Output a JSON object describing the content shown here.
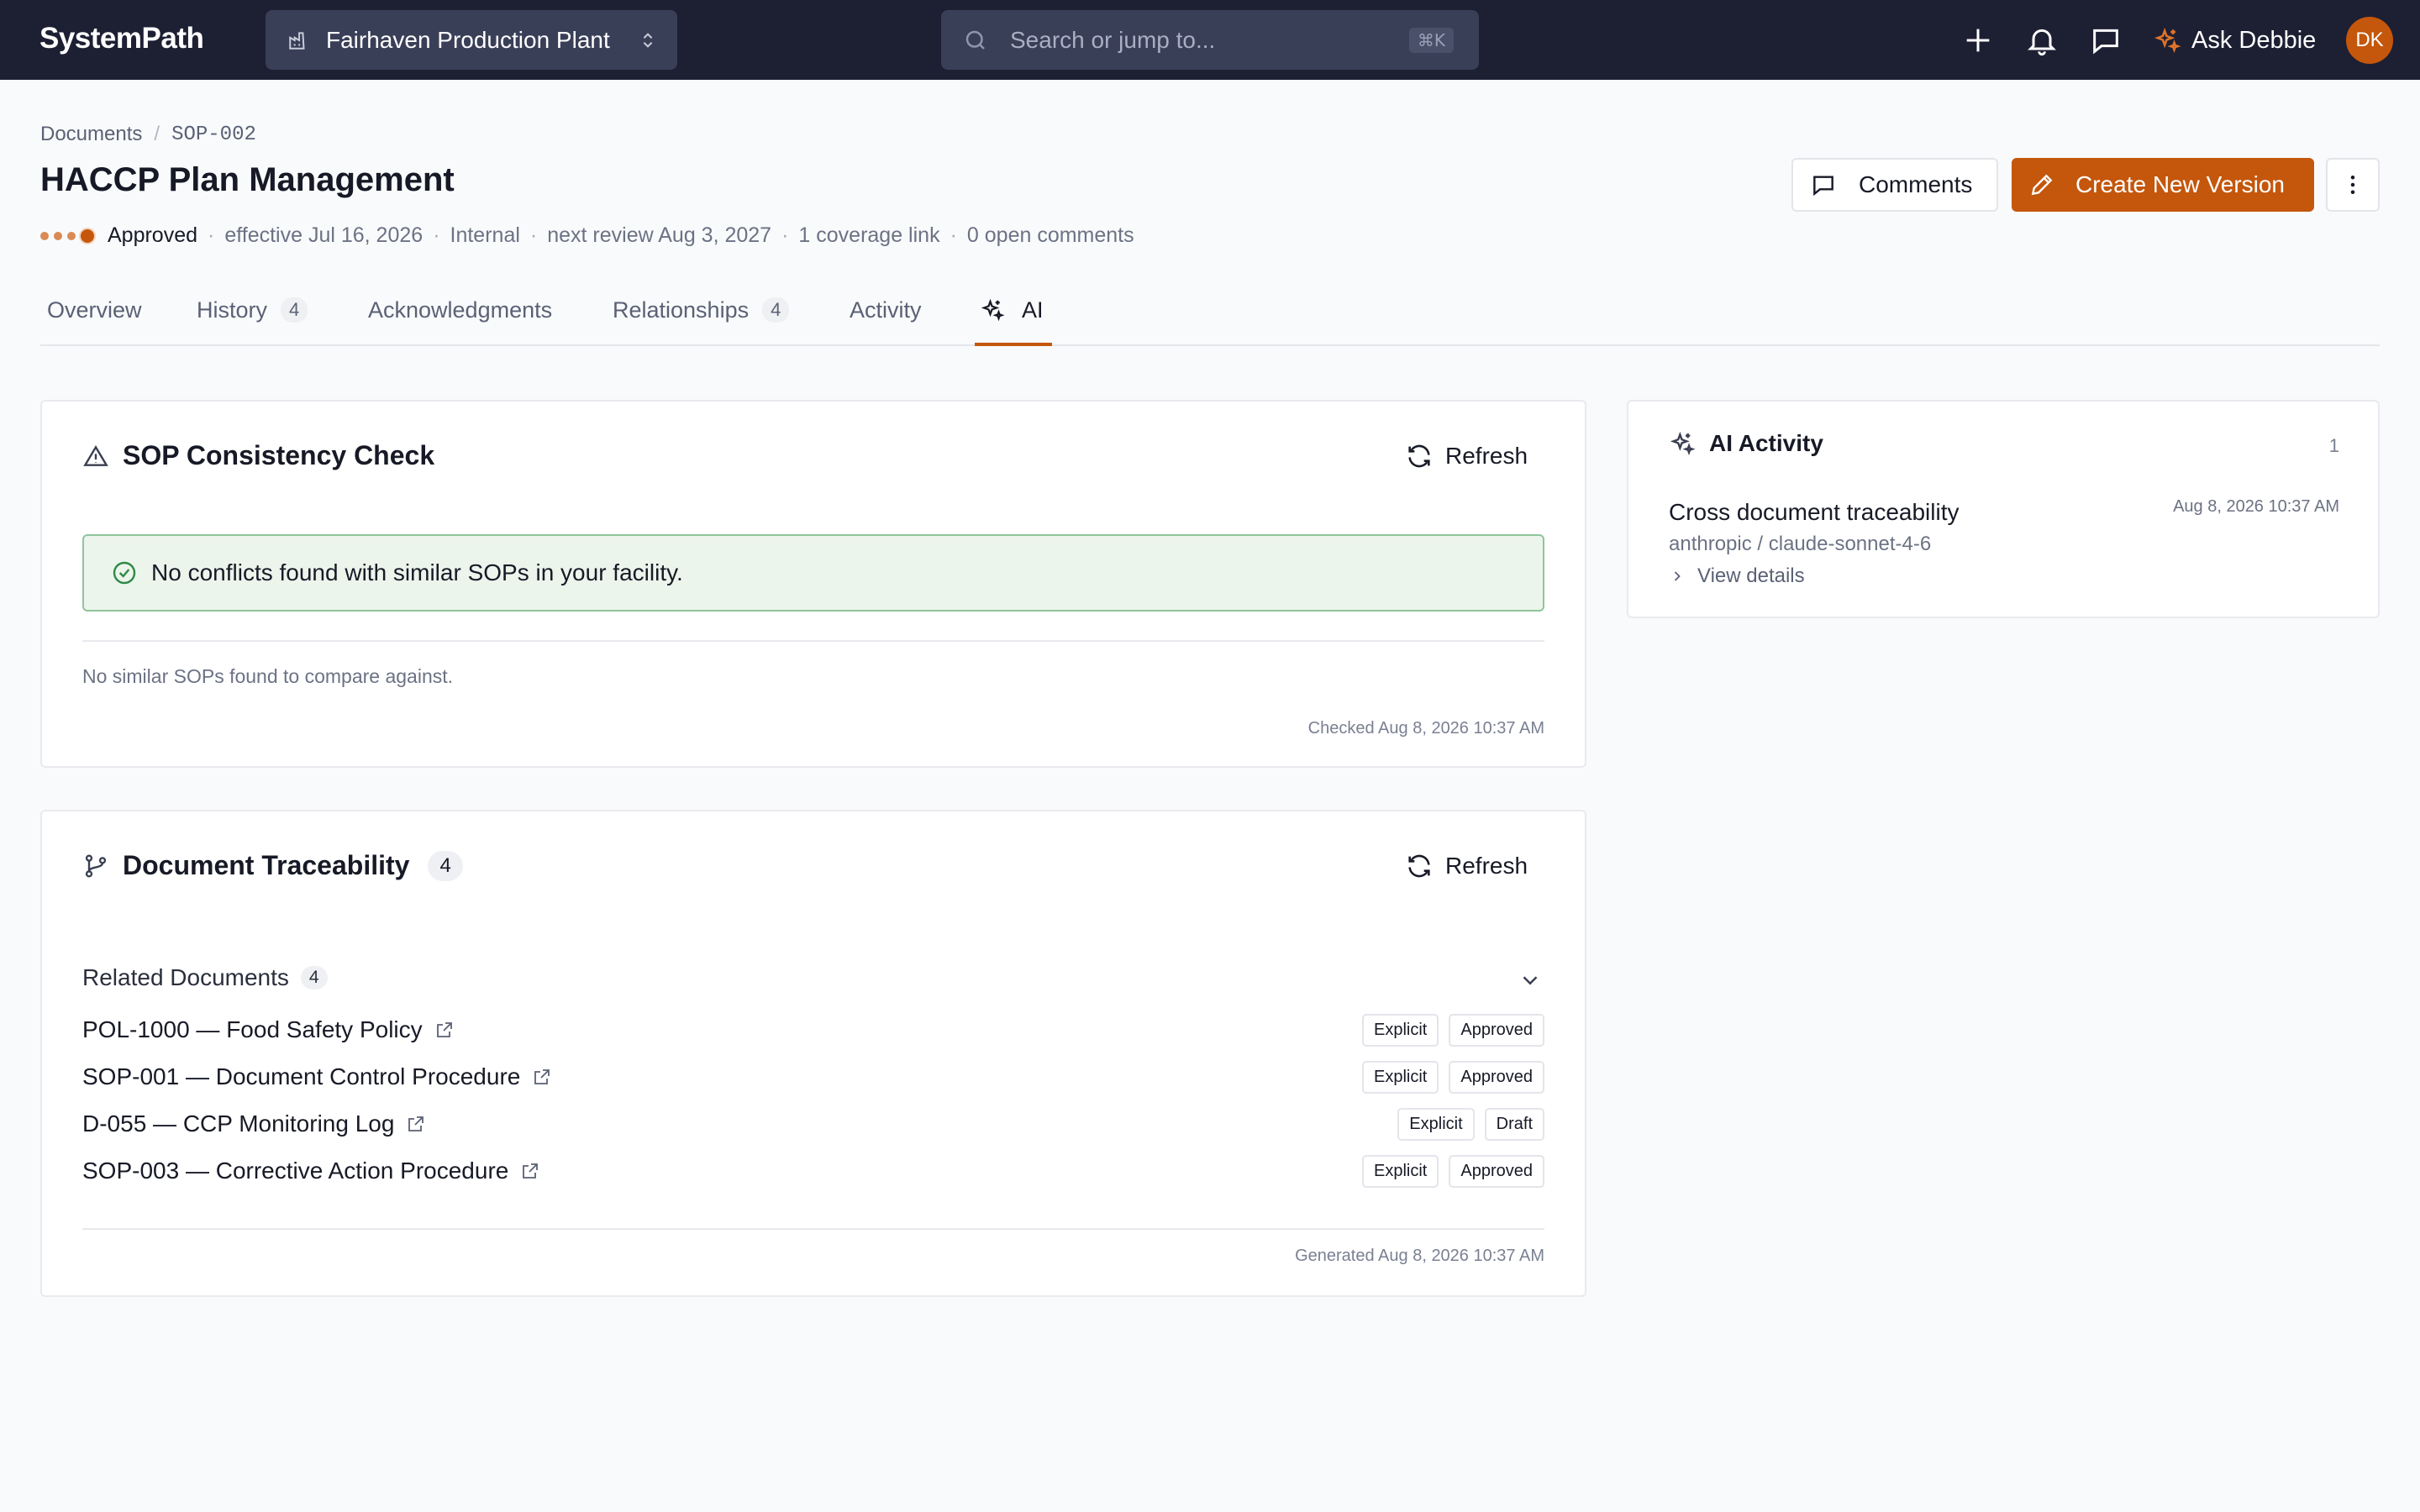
{
  "app": {
    "brand": "SystemPath"
  },
  "facility": {
    "name": "Fairhaven Production Plant"
  },
  "search": {
    "placeholder": "Search or jump to...",
    "shortcut": "⌘K"
  },
  "topbar": {
    "ask_label": "Ask Debbie",
    "avatar_initials": "DK"
  },
  "breadcrumb": {
    "root": "Documents",
    "current": "SOP-002"
  },
  "document": {
    "title": "HACCP Plan Management",
    "status": "Approved",
    "effective": "effective Jul 16, 2026",
    "visibility": "Internal",
    "next_review": "next review Aug 3, 2027",
    "coverage": "1 coverage link",
    "comments": "0 open comments"
  },
  "actions": {
    "comments_label": "Comments",
    "create_label": "Create New Version"
  },
  "tabs": [
    {
      "label": "Overview"
    },
    {
      "label": "History",
      "count": "4"
    },
    {
      "label": "Acknowledgments"
    },
    {
      "label": "Relationships",
      "count": "4"
    },
    {
      "label": "Activity"
    },
    {
      "label": "AI",
      "active": true
    }
  ],
  "consistency": {
    "title": "SOP Consistency Check",
    "refresh_label": "Refresh",
    "alert": "No conflicts found with similar SOPs in your facility.",
    "note": "No similar SOPs found to compare against.",
    "checked": "Checked Aug 8, 2026 10:37 AM"
  },
  "traceability": {
    "title": "Document Traceability",
    "count": "4",
    "refresh_label": "Refresh",
    "related_label": "Related Documents",
    "related_count": "4",
    "documents": [
      {
        "name": "POL-1000 — Food Safety Policy",
        "type": "Explicit",
        "status": "Approved"
      },
      {
        "name": "SOP-001 — Document Control Procedure",
        "type": "Explicit",
        "status": "Approved"
      },
      {
        "name": "D-055 — CCP Monitoring Log",
        "type": "Explicit",
        "status": "Draft"
      },
      {
        "name": "SOP-003 — Corrective Action Procedure",
        "type": "Explicit",
        "status": "Approved"
      }
    ],
    "generated": "Generated Aug 8, 2026 10:37 AM"
  },
  "ai_activity": {
    "title": "AI Activity",
    "count": "1",
    "item_title": "Cross document traceability",
    "item_time": "Aug 8, 2026 10:37 AM",
    "item_model": "anthropic / claude-sonnet-4-6",
    "details_label": "View details"
  },
  "colors": {
    "topbar": "#1d1f33",
    "accent": "#c4570c",
    "success_bg": "#ecf5ec",
    "success_border": "#8fc59a"
  },
  "icons": [
    "factory-icon",
    "updown-chevron-icon",
    "search-icon",
    "plus-icon",
    "bell-icon",
    "chat-icon",
    "sparkle-icon",
    "comment-icon",
    "pencil-icon",
    "more-vertical-icon",
    "warning-icon",
    "refresh-icon",
    "check-circle-icon",
    "branch-icon",
    "chevron-down-icon",
    "external-link-icon",
    "chevron-right-icon"
  ]
}
